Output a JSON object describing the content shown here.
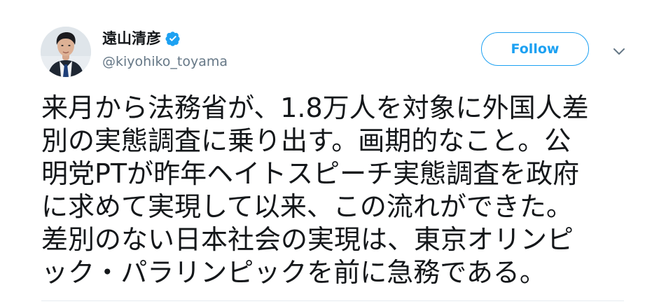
{
  "tweet": {
    "author": {
      "name": "遠山清彦",
      "handle": "@kiyohiko_toyama",
      "verified": true,
      "avatar_icon": "avatar-profile-photo"
    },
    "actions": {
      "follow_label": "Follow",
      "menu_icon": "chevron-down-icon"
    },
    "text_lines": [
      "来月から法務省が、1.8万人を対象に外国人差",
      "別の実態調査に乗り出す。画期的なこと。公",
      "明党PTが昨年ヘイトスピーチ実態調査を政府",
      "に求めて実現して以来、この流れができた。",
      "差別のない日本社会の実現は、東京オリンピ",
      "ック・パラリンピックを前に急務である。"
    ]
  },
  "colors": {
    "brand_blue": "#1da1f2",
    "text_primary": "#14171a",
    "text_secondary": "#657786",
    "divider": "#e6ecf0"
  }
}
